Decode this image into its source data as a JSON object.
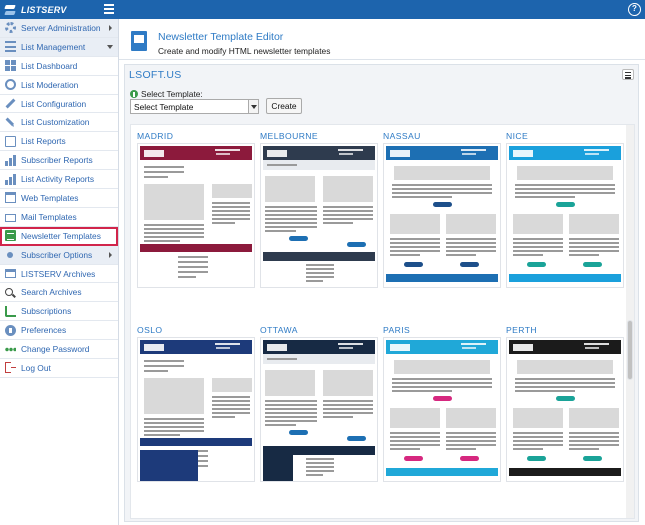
{
  "app": {
    "name": "LISTSERV"
  },
  "sidebar": {
    "items": [
      {
        "label": "Server Administration",
        "icon": "gear-icon",
        "group": true,
        "expand": "right"
      },
      {
        "label": "List Management",
        "icon": "list-icon",
        "group": true,
        "expand": "down"
      },
      {
        "label": "List Dashboard",
        "icon": "dashboard-icon"
      },
      {
        "label": "List Moderation",
        "icon": "moderation-icon"
      },
      {
        "label": "List Configuration",
        "icon": "wrench-icon"
      },
      {
        "label": "List Customization",
        "icon": "pencil-icon"
      },
      {
        "label": "List Reports",
        "icon": "report-icon"
      },
      {
        "label": "Subscriber Reports",
        "icon": "bar-chart-icon"
      },
      {
        "label": "List Activity Reports",
        "icon": "bar-chart-icon"
      },
      {
        "label": "Web Templates",
        "icon": "web-icon"
      },
      {
        "label": "Mail Templates",
        "icon": "mail-icon"
      },
      {
        "label": "Newsletter Templates",
        "icon": "newsletter-icon",
        "active": true
      },
      {
        "label": "Subscriber Options",
        "icon": "subscriber-icon",
        "group": true,
        "expand": "right"
      },
      {
        "label": "LISTSERV Archives",
        "icon": "archive-icon"
      },
      {
        "label": "Search Archives",
        "icon": "search-icon"
      },
      {
        "label": "Subscriptions",
        "icon": "rss-icon"
      },
      {
        "label": "Preferences",
        "icon": "preferences-icon"
      },
      {
        "label": "Change Password",
        "icon": "password-icon"
      },
      {
        "label": "Log Out",
        "icon": "logout-icon"
      }
    ]
  },
  "page": {
    "title": "Newsletter Template Editor",
    "subtitle": "Create and modify HTML newsletter templates"
  },
  "panel": {
    "title": "LSOFT.US",
    "select_label": "Select Template:",
    "select_value": "Select Template",
    "create_label": "Create"
  },
  "templates": [
    {
      "name": "MADRID",
      "accent": "#8c1a3c",
      "style": "madrid"
    },
    {
      "name": "MELBOURNE",
      "accent": "#2e3b4e",
      "style": "melbourne"
    },
    {
      "name": "NASSAU",
      "accent": "#1d6fb3",
      "style": "nassau"
    },
    {
      "name": "NICE",
      "accent": "#1aa0dc",
      "style": "nice"
    },
    {
      "name": "OSLO",
      "accent": "#1d3a7a",
      "style": "oslo"
    },
    {
      "name": "OTTAWA",
      "accent": "#172a44",
      "style": "ottawa"
    },
    {
      "name": "PARIS",
      "accent": "#20a8d8",
      "style": "paris"
    },
    {
      "name": "PERTH",
      "accent": "#1b1b1b",
      "style": "perth"
    }
  ]
}
